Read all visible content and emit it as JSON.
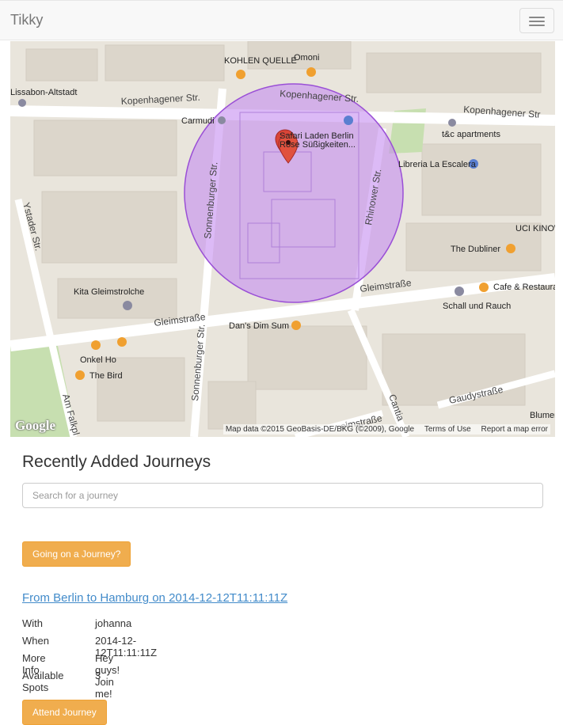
{
  "navbar": {
    "brand": "Tikky"
  },
  "map": {
    "places": {
      "kohlen_quelle": "KOHLEN QUELLE",
      "omoni": "Omoni",
      "lissabon": "Lissabon-Altstadt",
      "carmudi": "Carmudi",
      "safari": "Safari Laden Berlin",
      "suss": "Rose Süßigkeiten...",
      "tc_apartments": "t&c apartments",
      "libreria": "Libreria La Escalera",
      "uci": "UCI KINOW",
      "dubliner": "The Dubliner",
      "kita": "Kita Gleimstrolche",
      "cafe": "Cafe & Restaura",
      "schall": "Schall und Rauch",
      "dans": "Dan's Dim Sum",
      "onkel": "Onkel Ho",
      "bird": "The Bird",
      "blumen": "Blumen"
    },
    "streets": {
      "kopenhagener_left": "Kopenhagener Str.",
      "kopenhagener_mid": "Kopenhagener Str.",
      "kopenhagener_right": "Kopenhagener Str",
      "sonnenburger_top": "Sonnenburger Str.",
      "sonnenburger_bottom": "Sonnenburger Str.",
      "rhinower": "Rhinower Str.",
      "gleim_left": "Gleimstraße",
      "gleim_right": "Gleimstraße",
      "ystader": "Ystader Str.",
      "am_falkpl": "Am Falkpl",
      "gaudy": "Gaudystraße",
      "cantian": "Cantia",
      "gleim_bottom": "eimstraße"
    },
    "attribution": "Map data ©2015 GeoBasis-DE/BKG (©2009), Google",
    "terms": "Terms of Use",
    "report": "Report a map error",
    "google": "Google"
  },
  "journeys": {
    "heading": "Recently Added Journeys",
    "search_placeholder": "Search for a journey",
    "going_button": "Going on a Journey?",
    "items": [
      {
        "title": "From Berlin to Hamburg on 2014-12-12T11:11:11Z",
        "with_label": "With",
        "with": "johanna",
        "when_label": "When",
        "when": "2014-12-12T11:11:11Z",
        "info_label": "More Info",
        "info": "Hey guys! Join me!",
        "spots_label": "Available Spots",
        "spots": "3",
        "attend_button": "Attend Journey"
      }
    ]
  },
  "colors": {
    "accent": "#f0ad4e",
    "link": "#428bca",
    "radius_fill": "#c48cf0",
    "marker": "#d94537"
  }
}
